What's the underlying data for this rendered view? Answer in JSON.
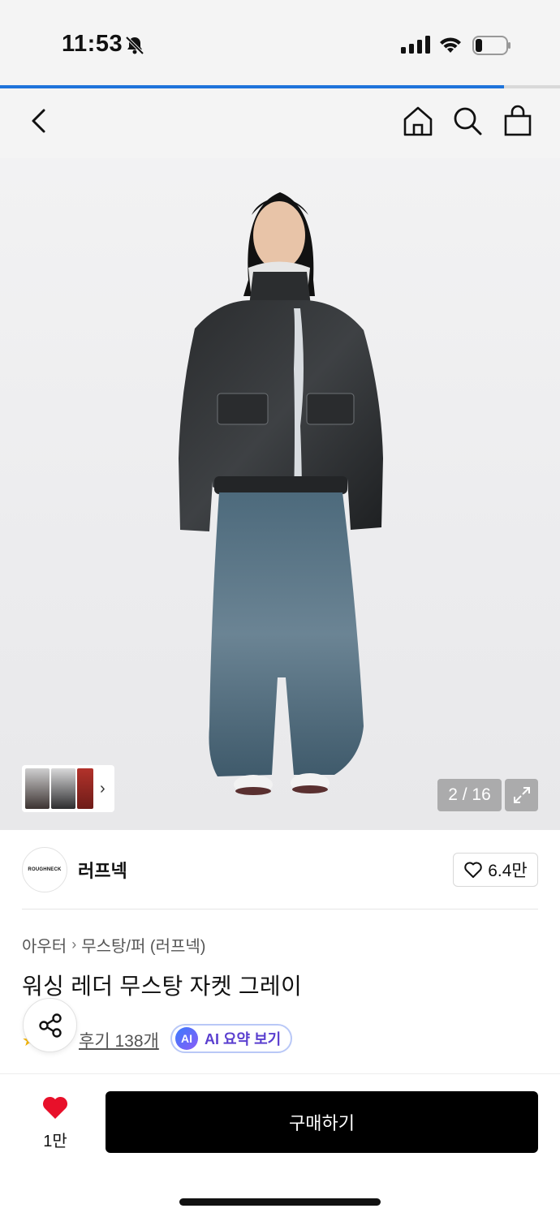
{
  "status_bar": {
    "time": "11:53",
    "icons": [
      "bell-slash-icon",
      "signal-icon",
      "wifi-icon",
      "battery-icon"
    ]
  },
  "page_progress": 0.9,
  "nav": {
    "icons": [
      "back-chevron-icon",
      "home-icon",
      "search-icon",
      "shopping-bag-icon"
    ]
  },
  "gallery": {
    "counter": "2 / 16",
    "expand_icon": "expand-icon"
  },
  "brand": {
    "logo_text": "ROUGHNECK",
    "name": "러프넥",
    "likes": "6.4만"
  },
  "product": {
    "breadcrumb": [
      "아우터",
      "무스탕/퍼 (러프넥)"
    ],
    "title": "워싱 레더 무스탕 자켓 그레이",
    "reviews": "후기 138개",
    "ai_badge": "AI",
    "ai_label": "AI 요약 보기"
  },
  "bottom_bar": {
    "like_count": "1만",
    "buy_label": "구매하기"
  },
  "colors": {
    "accent": "#1f74db",
    "heart": "#e8102a",
    "buy_button": "#000000"
  }
}
